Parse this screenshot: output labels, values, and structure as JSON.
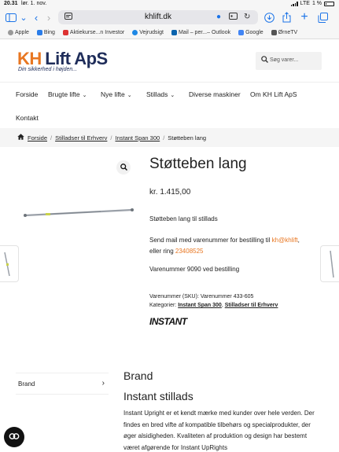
{
  "statusbar": {
    "time": "20.31",
    "date": "lør. 1. nov.",
    "network": "LTE",
    "battery": "1 %"
  },
  "browser": {
    "url": "khlift.dk",
    "bookmarks": [
      {
        "label": "Apple",
        "color": "#999999"
      },
      {
        "label": "Bing",
        "color": "#2b7de9"
      },
      {
        "label": "Aktiekurse...n Investor",
        "color": "#d33"
      },
      {
        "label": "Vejrudsigt",
        "color": "#1e88e5"
      },
      {
        "label": "Mail – per...– Outlook",
        "color": "#0a64ad"
      },
      {
        "label": "Google",
        "color": "#4285f4"
      },
      {
        "label": "ØrneTV",
        "color": "#555555"
      }
    ]
  },
  "site": {
    "logo_kh": "KH",
    "logo_rest": "Lift ApS",
    "tagline": "Din sikkerhed i højden...",
    "search_placeholder": "Søg varer...",
    "nav": [
      "Forside",
      "Brugte lifte",
      "Nye lifte",
      "Stillads",
      "Diverse maskiner",
      "Om KH Lift ApS",
      "Kontakt"
    ]
  },
  "breadcrumb": {
    "home": "Forside",
    "level1": "Stilladser til Erhverv",
    "level2": "Instant Span 300",
    "current": "Støtteben lang"
  },
  "product": {
    "title": "Støtteben lang",
    "price": "kr. 1.415,00",
    "short_description": "Støtteben lang til stillads",
    "mail_prefix": "Send mail med varenummer for bestilling til ",
    "mail_link": "kh@khlift",
    "mail_mid": ",",
    "phone_prefix": "eller ring ",
    "phone": "23408525",
    "item_number_text": "Varenummer 9090 ved bestilling",
    "sku_text": "Varenummer (SKU): Varenummer 433-605",
    "categories_label": "Kategorier: ",
    "category1": "Instant Span 300",
    "category_sep": ", ",
    "category2": "Stilladser til Erhverv",
    "brand_logo": "INSTANT"
  },
  "tabs": {
    "brand_tab": "Brand"
  },
  "brand_section": {
    "heading": "Brand",
    "subheading": "Instant stillads",
    "description": "Instant Upright er et kendt mærke med kunder over hele verden. Der findes en bred vifte af kompatible tilbehørs og specialprodukter, der øger alsidigheden. Kvaliteten af produktion og design har bestemt været afgørende for Instant UpRights"
  },
  "colors": {
    "accent": "#e87722",
    "brand_navy": "#1f2d5a",
    "link_blue": "#1a73e8"
  }
}
